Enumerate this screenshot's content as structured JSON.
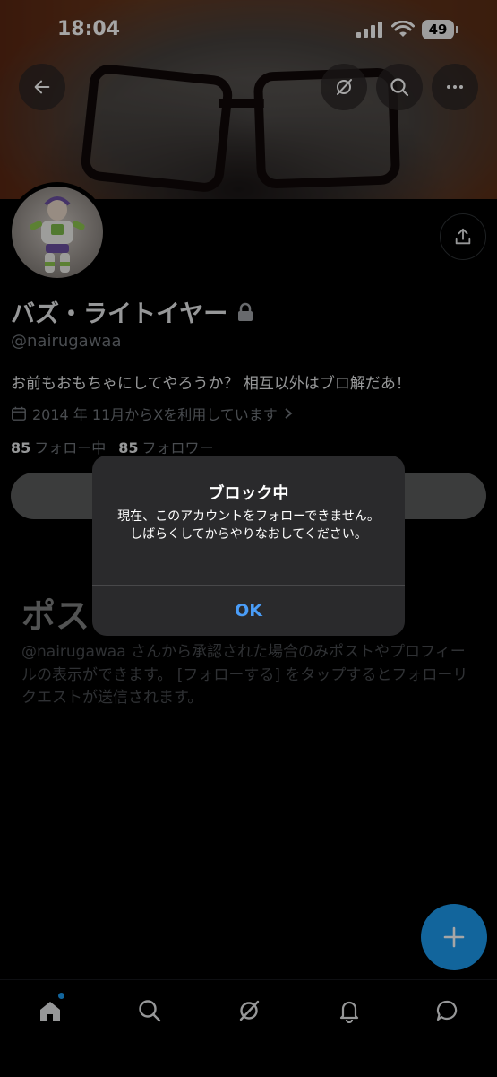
{
  "status": {
    "time": "18:04",
    "battery": "49"
  },
  "header": {
    "back_icon": "arrow-left-icon",
    "grok_icon": "grok-icon",
    "search_icon": "search-icon",
    "more_icon": "more-horizontal-icon",
    "share_icon": "share-icon"
  },
  "profile": {
    "name": "バズ・ライトイヤー",
    "lock_icon": "lock-icon",
    "handle": "@nairugawaa",
    "bio": "お前もおもちゃにしてやろうか？ 相互以外はブロ解だあ！",
    "joined": "2014 年 11月からXを利用しています",
    "following_count": "85",
    "following_label": "フォロー中",
    "followers_count": "85",
    "followers_label": "フォロワー"
  },
  "locked": {
    "title": "ポス",
    "description": "@nairugawaa さんから承認された場合のみポストやプロフィールの表示ができます。 [フォローする] をタップするとフォローリクエストが送信されます。"
  },
  "alert": {
    "title": "ブロック中",
    "message": "現在、このアカウントをフォローできません。しばらくしてからやりなおしてください。",
    "ok_label": "OK"
  },
  "fab": {
    "icon": "plus-icon"
  },
  "tabbar": {
    "items": [
      {
        "icon": "home-icon"
      },
      {
        "icon": "search-icon"
      },
      {
        "icon": "grok-icon"
      },
      {
        "icon": "bell-icon"
      },
      {
        "icon": "messages-icon"
      }
    ]
  },
  "colors": {
    "accent": "#1d9bf0",
    "alert_button": "#4a9df8",
    "alert_bg": "#2a2a2c"
  }
}
